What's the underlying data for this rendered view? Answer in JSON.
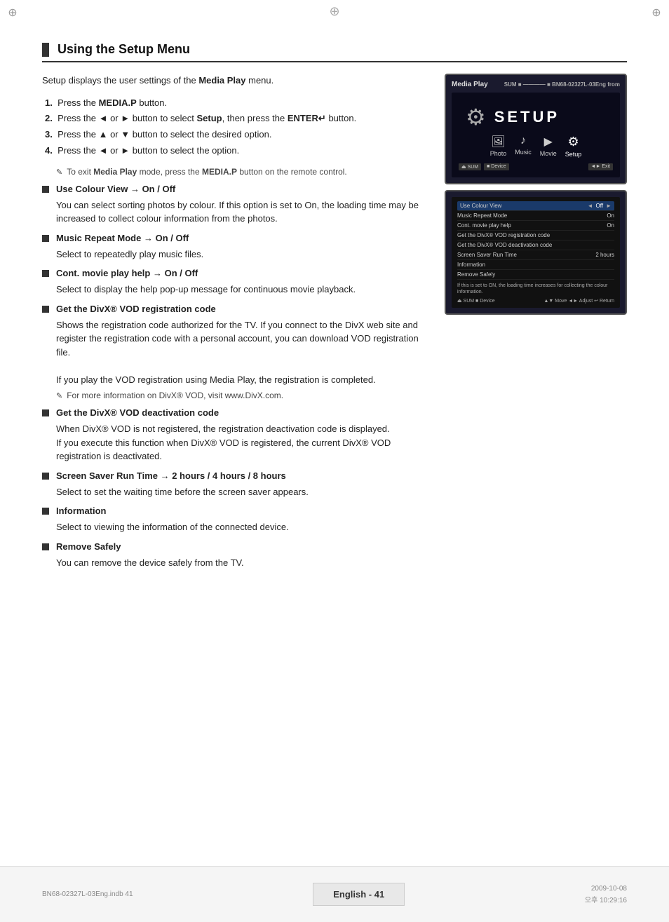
{
  "page": {
    "corner_marks": [
      "⊕",
      "⊕",
      "⊕",
      "⊕"
    ],
    "center_top_cross": "⊕",
    "center_bottom_cross": "⊕"
  },
  "section": {
    "title": "Using the Setup Menu",
    "title_bar": true
  },
  "intro": {
    "text": "Setup displays the user settings of the Media Play menu."
  },
  "steps": [
    {
      "num": "1.",
      "text": "Press the MEDIA.P button."
    },
    {
      "num": "2.",
      "text": "Press the ◄ or ► button to select Setup, then press the ENTER↵ button."
    },
    {
      "num": "3.",
      "text": "Press the ▲ or ▼ button to select the desired option."
    },
    {
      "num": "4.",
      "text": "Press the ◄ or ► button to select the option."
    }
  ],
  "note1": {
    "icon": "✎",
    "text": "To exit Media Play mode, press the MEDIA.P button on the remote control."
  },
  "bullets": [
    {
      "id": "colour-view",
      "title": "Use Colour View → On / Off",
      "body": "You can select sorting photos by colour. If this option is set to On, the loading time may be increased to collect colour information from the photos."
    },
    {
      "id": "music-repeat",
      "title": "Music Repeat Mode → On / Off",
      "body": "Select to repeatedly play music files."
    },
    {
      "id": "cont-movie",
      "title": "Cont. movie play help → On / Off",
      "body": "Select to display the help pop-up message for continuous movie playback."
    },
    {
      "id": "divx-reg",
      "title": "Get the DivX® VOD registration code",
      "body": "Shows the registration code authorized for the TV. If you connect to the DivX web site and register the registration code with a personal account, you can download VOD registration file.",
      "extra_line": "If you play the VOD registration using Media Play, the registration is completed.",
      "note": "For more information on DivX® VOD, visit www.DivX.com."
    },
    {
      "id": "divx-deact",
      "title": "Get the DivX® VOD deactivation code",
      "body": "When DivX® VOD is not registered, the registration deactivation code is displayed.",
      "extra_line": "If you execute this function when DivX® VOD is registered, the current DivX® VOD registration is deactivated."
    },
    {
      "id": "screen-saver",
      "title": "Screen Saver Run Time → 2 hours / 4 hours / 8 hours",
      "body": "Select to set the waiting time before the screen saver appears."
    },
    {
      "id": "information",
      "title": "Information",
      "body": "Select to viewing the information of the connected device."
    },
    {
      "id": "remove-safely",
      "title": "Remove Safely",
      "body": "You can remove the device safely from the TV."
    }
  ],
  "screenshots": {
    "screen1": {
      "title_left": "Media Play",
      "title_right": "SUM",
      "subtitle": "SETUP",
      "icons": [
        {
          "label": "Photo",
          "symbol": "🖼",
          "active": false
        },
        {
          "label": "Music",
          "symbol": "♪",
          "active": false
        },
        {
          "label": "Movie",
          "symbol": "🎬",
          "active": false
        },
        {
          "label": "Setup",
          "symbol": "⚙",
          "active": true
        }
      ],
      "bottom_bar_left": "SUM",
      "bottom_bar_device": "Device",
      "bottom_bar_right": "◄► Exit"
    },
    "screen2": {
      "rows": [
        {
          "label": "Use Colour View",
          "value": "Off",
          "arrows": true,
          "active": true
        },
        {
          "label": "Music Repeat Mode",
          "value": "On",
          "arrows": false
        },
        {
          "label": "Cont. movie play help",
          "value": "On",
          "arrows": false
        },
        {
          "label": "Get the DivX® VOD registration code",
          "value": "",
          "arrows": false
        },
        {
          "label": "Get the DivX® VOD deactivation code",
          "value": "",
          "arrows": false
        },
        {
          "label": "Screen Saver Run Time",
          "value": "2 hours",
          "arrows": false
        },
        {
          "label": "Information",
          "value": "",
          "arrows": false
        },
        {
          "label": "Remove Safely",
          "value": "",
          "arrows": false
        }
      ],
      "note": "If this is set to ON, the loading time increases for collecting the colour information.",
      "nav_items": [
        "Move",
        "Adjust",
        "Return"
      ]
    }
  },
  "footer": {
    "left_text": "BN68-02327L-03Eng.indb   41",
    "center_text": "English - 41",
    "right_date": "2009-10-08",
    "right_time": "오후 10:29:16"
  }
}
